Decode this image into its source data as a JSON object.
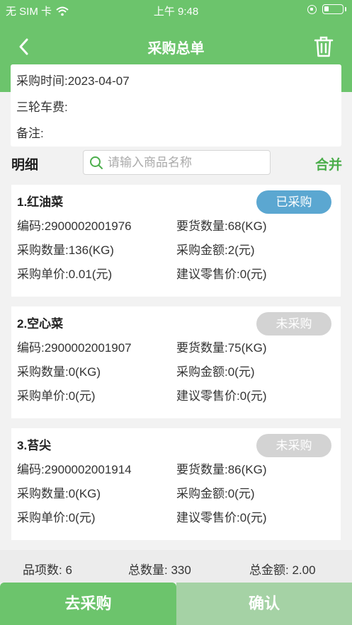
{
  "status_bar": {
    "carrier": "无 SIM 卡",
    "time": "上午 9:48"
  },
  "header": {
    "title": "采购总单",
    "back_icon": "chevron-left-icon",
    "trash_icon": "trash-icon"
  },
  "info": {
    "purchase_time": "采购时间:2023-04-07",
    "tricycle_fee": "三轮车费:",
    "remark": "备注:"
  },
  "toolbar": {
    "detail_label": "明细",
    "search_placeholder": "请输入商品名称",
    "merge_label": "合并"
  },
  "items": [
    {
      "name": "1.红油菜",
      "status": "已采购",
      "code": "编码:2900002001976",
      "demand_qty": "要货数量:68(KG)",
      "purchase_qty": "采购数量:136(KG)",
      "purchase_amount": "采购金额:2(元)",
      "unit_price": "采购单价:0.01(元)",
      "retail_price": "建议零售价:0(元)"
    },
    {
      "name": "2.空心菜",
      "status": "未采购",
      "code": "编码:2900002001907",
      "demand_qty": "要货数量:75(KG)",
      "purchase_qty": "采购数量:0(KG)",
      "purchase_amount": "采购金额:0(元)",
      "unit_price": "采购单价:0(元)",
      "retail_price": "建议零售价:0(元)"
    },
    {
      "name": "3.苔尖",
      "status": "未采购",
      "code": "编码:2900002001914",
      "demand_qty": "要货数量:86(KG)",
      "purchase_qty": "采购数量:0(KG)",
      "purchase_amount": "采购金额:0(元)",
      "unit_price": "采购单价:0(元)",
      "retail_price": "建议零售价:0(元)"
    }
  ],
  "summary": {
    "item_count": "品项数: 6",
    "total_qty": "总数量: 330",
    "total_amount": "总金额: 2.00"
  },
  "actions": {
    "go_purchase": "去采购",
    "confirm": "确认"
  },
  "colors": {
    "brand_green": "#6cc46c",
    "purchased_blue": "#5ba7d1",
    "not_purchased_gray": "#d3d3d3",
    "confirm_disabled": "#a5d2a5"
  }
}
